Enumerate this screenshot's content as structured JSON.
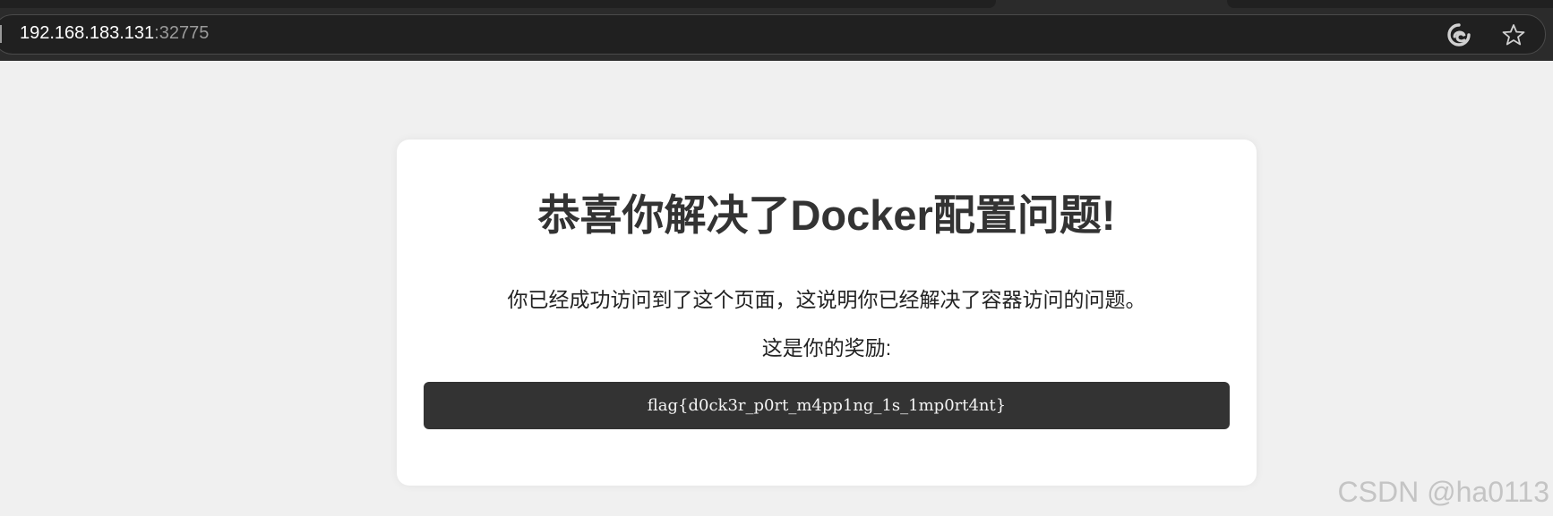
{
  "browser": {
    "url_host": "192.168.183.131",
    "url_port": ":32775",
    "icons": [
      "refresh-edge-icon",
      "favorite-star-icon"
    ]
  },
  "page": {
    "title": "恭喜你解决了Docker配置问题!",
    "description": "你已经成功访问到了这个页面，这说明你已经解决了容器访问的问题。",
    "reward_label": "这是你的奖励:",
    "flag": "flag{d0ck3r_p0rt_m4pp1ng_1s_1mp0rt4nt}"
  },
  "watermark": "CSDN @ha0113",
  "colors": {
    "browser_bg": "#2b2b2b",
    "page_bg": "#f0f0f0",
    "card_bg": "#ffffff",
    "flag_bg": "#333333",
    "title_color": "#333333"
  }
}
